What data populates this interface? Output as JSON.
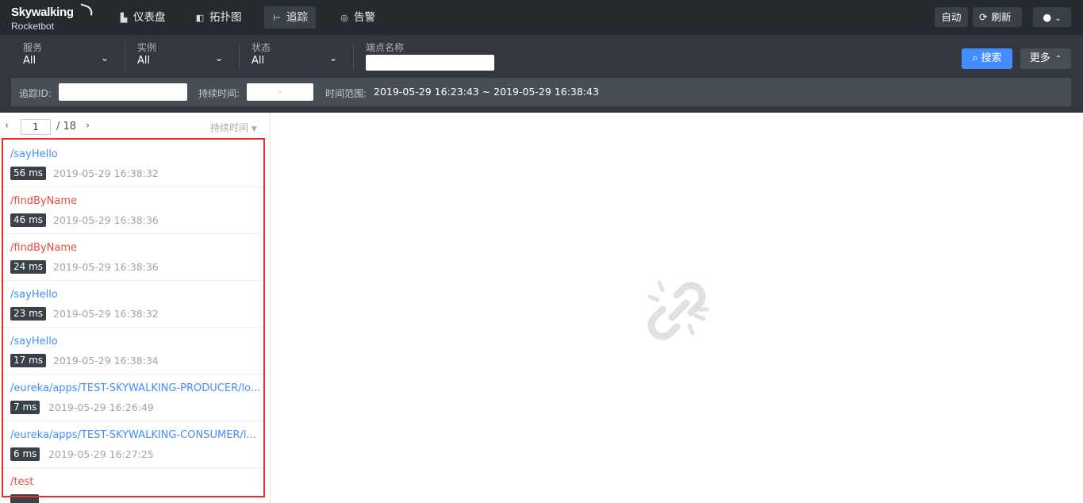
{
  "brand": {
    "name": "Skywalking",
    "sub": "Rocketbot"
  },
  "nav": [
    {
      "label": "仪表盘",
      "icon": "dashboard-icon"
    },
    {
      "label": "拓扑图",
      "icon": "topology-icon"
    },
    {
      "label": "追踪",
      "icon": "trace-icon",
      "active": true
    },
    {
      "label": "告警",
      "icon": "alarm-icon"
    }
  ],
  "header_right": {
    "auto_label": "自动",
    "refresh_label": "刷新"
  },
  "filters": {
    "service": {
      "label": "服务",
      "value": "All"
    },
    "instance": {
      "label": "实例",
      "value": "All"
    },
    "status": {
      "label": "状态",
      "value": "All"
    },
    "endpoint": {
      "label": "端点名称",
      "value": ""
    },
    "search_label": "搜索",
    "more_label": "更多",
    "trace_id_label": "追踪ID:",
    "trace_id_value": "",
    "duration_label": "持续时间:",
    "duration_value": "-",
    "time_range_label": "时间范围:",
    "time_range_value": "2019-05-29 16:23:43 ~ 2019-05-29 16:38:43"
  },
  "pager": {
    "current": "1",
    "total": "/ 18",
    "sort_label": "持续时间"
  },
  "traces": [
    {
      "name": "/sayHello",
      "error": false,
      "duration": "56 ms",
      "time": "2019-05-29 16:38:32"
    },
    {
      "name": "/findByName",
      "error": true,
      "duration": "46 ms",
      "time": "2019-05-29 16:38:36"
    },
    {
      "name": "/findByName",
      "error": true,
      "duration": "24 ms",
      "time": "2019-05-29 16:38:36"
    },
    {
      "name": "/sayHello",
      "error": false,
      "duration": "23 ms",
      "time": "2019-05-29 16:38:32"
    },
    {
      "name": "/sayHello",
      "error": false,
      "duration": "17 ms",
      "time": "2019-05-29 16:38:34"
    },
    {
      "name": "/eureka/apps/TEST-SKYWALKING-PRODUCER/lo...",
      "error": false,
      "duration": "7 ms",
      "time": "2019-05-29 16:26:49"
    },
    {
      "name": "/eureka/apps/TEST-SKYWALKING-CONSUMER/l...",
      "error": false,
      "duration": "6 ms",
      "time": "2019-05-29 16:27:25"
    },
    {
      "name": "/test",
      "error": true,
      "duration": "",
      "time": ""
    }
  ],
  "colors": {
    "accent": "#448dfe",
    "error": "#e54c3c",
    "topbar": "#252a2f",
    "filterbar": "#333840",
    "highlight": "#e8302a"
  }
}
